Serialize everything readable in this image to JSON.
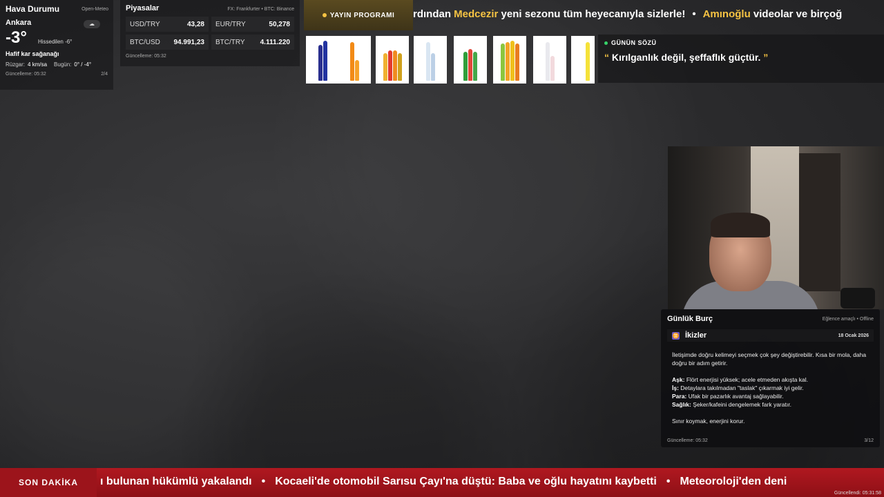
{
  "weather": {
    "title": "Hava Durumu",
    "source": "Open-Meteo",
    "city": "Ankara",
    "icon": "snow-cloud-icon",
    "temperature": "-3°",
    "feels_like": "Hissedilen -6°",
    "condition": "Hafif kar sağanağı",
    "wind_label": "Rüzgar:",
    "wind_value": "4 km/sa",
    "today_label": "Bugün:",
    "today_value": "0° / -4°",
    "updated": "Güncelleme: 05:32",
    "page": "2/4"
  },
  "markets": {
    "title": "Piyasalar",
    "source": "FX: Frankfurter • BTC: Binance",
    "rates": [
      {
        "label": "USD/TRY",
        "value": "43,28"
      },
      {
        "label": "EUR/TRY",
        "value": "50,278"
      },
      {
        "label": "BTC/USD",
        "value": "94.991,23"
      },
      {
        "label": "BTC/TRY",
        "value": "4.111.220"
      }
    ],
    "updated": "Güncelleme: 05:32"
  },
  "top_ticker": {
    "label": "YAYIN PROGRAMI",
    "text_pre": "rdından ",
    "highlight1": "Medcezir",
    "text_mid": " yeni sezonu tüm heyecanıyla sizlerle!",
    "separator": "•",
    "highlight2": "Amınoğlu",
    "text_post": " videolar ve birçoğ"
  },
  "quote": {
    "label": "GÜNÜN SÖZÜ",
    "open_mark": "“",
    "text": "Kırılganlık değil, şeffaflık güçtür.",
    "close_mark": "”"
  },
  "horoscope": {
    "title": "Günlük Burç",
    "source": "Eğlence amaçlı • Offline",
    "sign_icon": "gemini-icon",
    "sign": "İkizler",
    "date": "18 Ocak 2026",
    "intro": "İletişimde doğru kelimeyi seçmek çok şey değiştirebilir. Kısa bir mola, daha doğru bir adım getirir.",
    "lines": [
      {
        "label": "Aşk:",
        "text": "Flört enerjisi yüksek; acele etmeden akışta kal."
      },
      {
        "label": "İş:",
        "text": "Detaylara takılmadan \"taslak\" çıkarmak iyi gelir."
      },
      {
        "label": "Para:",
        "text": "Ufak bir pazarlık avantaj sağlayabilir."
      },
      {
        "label": "Sağlık:",
        "text": "Şeker/kafeini dengelemek fark yaratır."
      }
    ],
    "closing": "Sınır koymak, enerjini korur.",
    "updated": "Güncelleme: 05:32",
    "page": "3/12"
  },
  "breaking": {
    "label": "SON DAKİKA",
    "items": [
      "ı bulunan hükümlü yakalandı",
      "Kocaeli'de otomobil Sarısu Çayı'na düştü: Baba ve oğlu hayatını kaybetti",
      "Meteoroloji'den deni"
    ],
    "separator": "•",
    "updated": "Güncellendi: 05:31:58"
  },
  "colors": {
    "accent_yellow": "#f6c343",
    "breaking_red": "#b01820",
    "live_green": "#36d36a"
  }
}
